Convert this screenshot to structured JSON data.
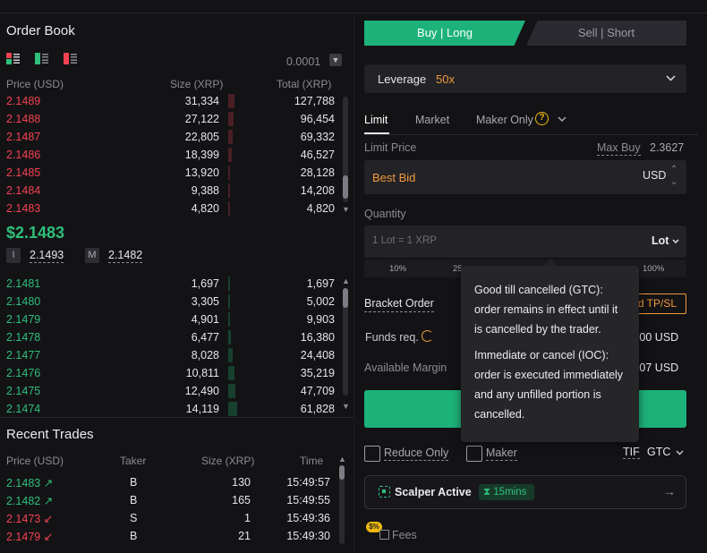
{
  "order_book": {
    "title": "Order Book",
    "precision": "0.0001",
    "headers": {
      "price": "Price (USD)",
      "size": "Size (XRP)",
      "total": "Total (XRP)"
    },
    "asks": [
      {
        "price": "2.1489",
        "size": "31,334",
        "total": "127,788",
        "depth": 0.55
      },
      {
        "price": "2.1488",
        "size": "27,122",
        "total": "96,454",
        "depth": 0.48
      },
      {
        "price": "2.1487",
        "size": "22,805",
        "total": "69,332",
        "depth": 0.38
      },
      {
        "price": "2.1486",
        "size": "18,399",
        "total": "46,527",
        "depth": 0.3
      },
      {
        "price": "2.1485",
        "size": "13,920",
        "total": "28,128",
        "depth": 0.2
      },
      {
        "price": "2.1484",
        "size": "9,388",
        "total": "14,208",
        "depth": 0.12
      },
      {
        "price": "2.1483",
        "size": "4,820",
        "total": "4,820",
        "depth": 0.06
      }
    ],
    "mid_price": "$2.1483",
    "index_label": "I",
    "index_price": "2.1493",
    "mark_label": "M",
    "mark_price": "2.1482",
    "bids": [
      {
        "price": "2.1481",
        "size": "1,697",
        "total": "1,697",
        "depth": 0.03
      },
      {
        "price": "2.1480",
        "size": "3,305",
        "total": "5,002",
        "depth": 0.1
      },
      {
        "price": "2.1479",
        "size": "4,901",
        "total": "9,903",
        "depth": 0.18
      },
      {
        "price": "2.1478",
        "size": "6,477",
        "total": "16,380",
        "depth": 0.28
      },
      {
        "price": "2.1477",
        "size": "8,028",
        "total": "24,408",
        "depth": 0.4
      },
      {
        "price": "2.1476",
        "size": "10,811",
        "total": "35,219",
        "depth": 0.55
      },
      {
        "price": "2.1475",
        "size": "12,490",
        "total": "47,709",
        "depth": 0.7
      },
      {
        "price": "2.1474",
        "size": "14,119",
        "total": "61,828",
        "depth": 0.85
      }
    ]
  },
  "recent_trades": {
    "title": "Recent Trades",
    "headers": {
      "price": "Price (USD)",
      "taker": "Taker",
      "size": "Size (XRP)",
      "time": "Time"
    },
    "rows": [
      {
        "price": "2.1483",
        "dir": "up",
        "taker": "B",
        "size": "130",
        "time": "15:49:57"
      },
      {
        "price": "2.1482",
        "dir": "up",
        "taker": "B",
        "size": "165",
        "time": "15:49:55"
      },
      {
        "price": "2.1473",
        "dir": "down",
        "taker": "S",
        "size": "1",
        "time": "15:49:36"
      },
      {
        "price": "2.1479",
        "dir": "down",
        "taker": "B",
        "size": "21",
        "time": "15:49:30"
      }
    ]
  },
  "order_form": {
    "buy_tab": "Buy | Long",
    "sell_tab": "Sell | Short",
    "leverage_label": "Leverage",
    "leverage_value": "50x",
    "order_types": [
      "Limit",
      "Market",
      "Maker Only"
    ],
    "limit_price_label": "Limit Price",
    "max_buy_label": "Max Buy",
    "max_buy_value": "2.3627",
    "price_value": "Best Bid",
    "price_unit": "USD",
    "quantity_label": "Quantity",
    "quantity_placeholder": "1 Lot = 1 XRP",
    "quantity_unit": "Lot",
    "percent_marks": [
      "10%",
      "25",
      "100%"
    ],
    "bracket_order": "Bracket Order",
    "tpsl_button": "d TP/SL",
    "funds_req_label": "Funds req.",
    "funds_req_value": "0.00 USD",
    "available_margin_label": "Available Margin",
    "available_margin_value": "0.07 USD",
    "reduce_only": "Reduce Only",
    "maker": "Maker",
    "tif_label": "TIF",
    "tif_value": "GTC",
    "scalper_label": "Scalper Active",
    "scalper_time": "15mins",
    "fees_badge": "$%",
    "fees_label": "Fees"
  },
  "tooltip": {
    "gtc_text": "Good till cancelled (GTC): order remains in effect until it is cancelled by the trader.",
    "ioc_text": "Immediate or cancel (IOC): order is executed immediately and any unfilled portion is cancelled."
  },
  "colors": {
    "ask": "#f2424f",
    "bid": "#2fbf7a",
    "accent": "#1db27a",
    "highlight": "#f29a3a"
  },
  "icons": [
    "book-view-both-icon",
    "book-view-bids-icon",
    "book-view-asks-icon",
    "chevron-down-icon",
    "help-icon",
    "refresh-icon",
    "scalper-icon",
    "hourglass-icon",
    "arrow-right-icon",
    "fees-icon"
  ]
}
